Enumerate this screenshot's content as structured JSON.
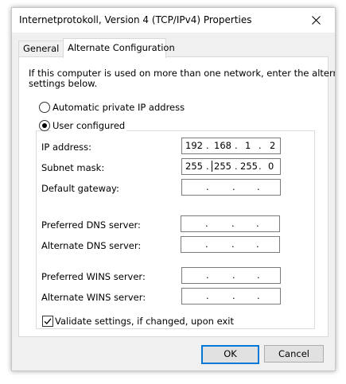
{
  "window": {
    "title": "Internetprotokoll, Version 4 (TCP/IPv4) Properties"
  },
  "tabs": [
    {
      "label": "General",
      "active": false
    },
    {
      "label": "Alternate Configuration",
      "active": true
    }
  ],
  "description": {
    "line1": "If this computer is used on more than one network, enter the alternate IP",
    "line2": "settings below."
  },
  "options": {
    "automatic_label": "Automatic private IP address",
    "automatic_selected": false,
    "user_configured_label": "User configured",
    "user_configured_selected": true
  },
  "fields": {
    "ip_address": {
      "label": "IP address:",
      "octets": [
        "192",
        "168",
        "1",
        "2"
      ]
    },
    "subnet_mask": {
      "label": "Subnet mask:",
      "octets": [
        "255",
        "255",
        "255",
        "0"
      ]
    },
    "default_gateway": {
      "label": "Default gateway:",
      "octets": [
        "",
        "",
        "",
        ""
      ]
    },
    "preferred_dns": {
      "label": "Preferred DNS server:",
      "octets": [
        "",
        "",
        "",
        ""
      ]
    },
    "alternate_dns": {
      "label": "Alternate DNS server:",
      "octets": [
        "",
        "",
        "",
        ""
      ]
    },
    "preferred_wins": {
      "label": "Preferred WINS server:",
      "octets": [
        "",
        "",
        "",
        ""
      ]
    },
    "alternate_wins": {
      "label": "Alternate WINS server:",
      "octets": [
        "",
        "",
        "",
        ""
      ]
    }
  },
  "validate": {
    "label": "Validate settings, if changed, upon exit",
    "checked": true
  },
  "buttons": {
    "ok": "OK",
    "cancel": "Cancel"
  },
  "colors": {
    "accent": "#0078d7",
    "window_bg": "#f0f0f0",
    "panel_bg": "#ffffff"
  },
  "icons": {
    "close": "close-icon",
    "radio": "radio-button",
    "check": "checkmark-icon"
  }
}
